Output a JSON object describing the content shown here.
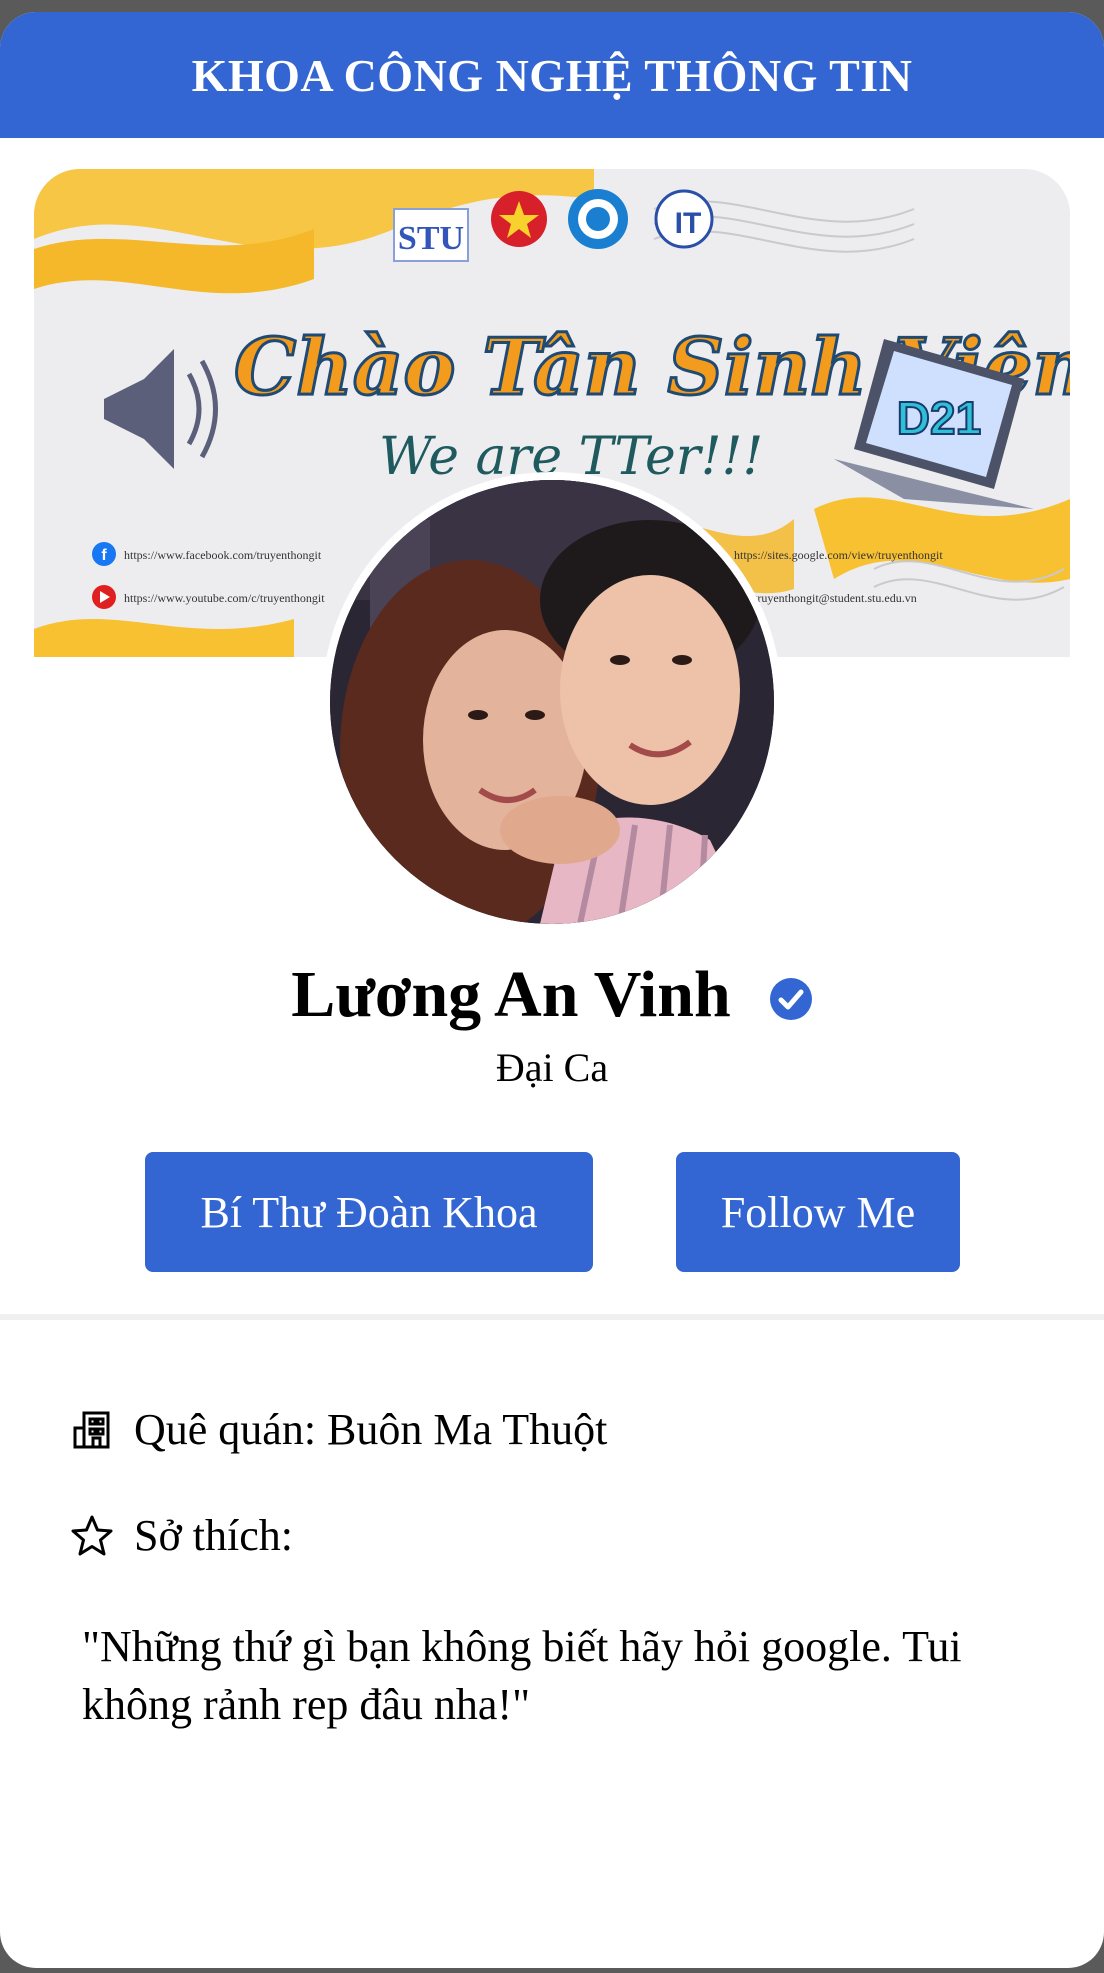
{
  "header": {
    "title": "KHOA CÔNG NGHỆ THÔNG TIN"
  },
  "banner": {
    "logos": [
      "STU",
      "IT"
    ],
    "headline": "Chào Tân Sinh Viên",
    "subline": "We are TTer!!!",
    "badge": "D21",
    "links": {
      "facebook": "https://www.facebook.com/truyenthongit",
      "youtube": "https://www.youtube.com/c/truyenthongit",
      "sites": "https://sites.google.com/view/truyenthongit",
      "email": "truyenthongit@student.stu.edu.vn"
    }
  },
  "profile": {
    "name": "Lương An Vinh",
    "role": "Đại Ca",
    "verified": true
  },
  "buttons": {
    "role_label": "Bí Thư Đoàn Khoa",
    "follow_label": "Follow Me"
  },
  "info": {
    "hometown": "Quê quán: Buôn Ma Thuột",
    "hobby": "Sở thích:",
    "quote": "\"Những thứ gì bạn không biết hãy hỏi google. Tui không rảnh rep đâu nha!\""
  },
  "icons": {
    "hometown": "building-icon",
    "hobby": "star-icon",
    "verified": "verified-check-icon"
  },
  "colors": {
    "accent": "#3366d2",
    "verified": "#3366d2"
  }
}
